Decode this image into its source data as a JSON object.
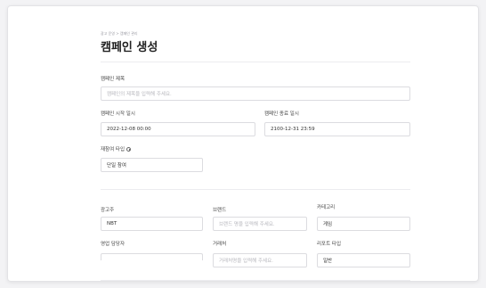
{
  "breadcrumb": "광고 운영 > 캠페인 관리",
  "page_title": "캠페인 생성",
  "campaign_title": {
    "label": "캠페인 제목",
    "placeholder": "캠페인의 제목을 입력해 주세요."
  },
  "start_datetime": {
    "label": "캠페인 시작 일시",
    "value": "2022-12-08 00:00"
  },
  "end_datetime": {
    "label": "캠페인 종료 일시",
    "value": "2100-12-31 23:59"
  },
  "participant_type": {
    "label": "재참여 타입",
    "value": "단일 참여"
  },
  "advertiser": {
    "label": "광고주",
    "value": "NBT"
  },
  "brand": {
    "label": "브랜드",
    "placeholder": "브랜드 명을 입력해 주세요."
  },
  "category": {
    "label": "카테고리",
    "value": "게임"
  },
  "sales_manager": {
    "label": "영업 담당자",
    "value": ""
  },
  "client": {
    "label": "거래처",
    "placeholder": "거래처명을 입력해 주세요."
  },
  "report_type": {
    "label": "리포트 타입",
    "value": "일반"
  }
}
